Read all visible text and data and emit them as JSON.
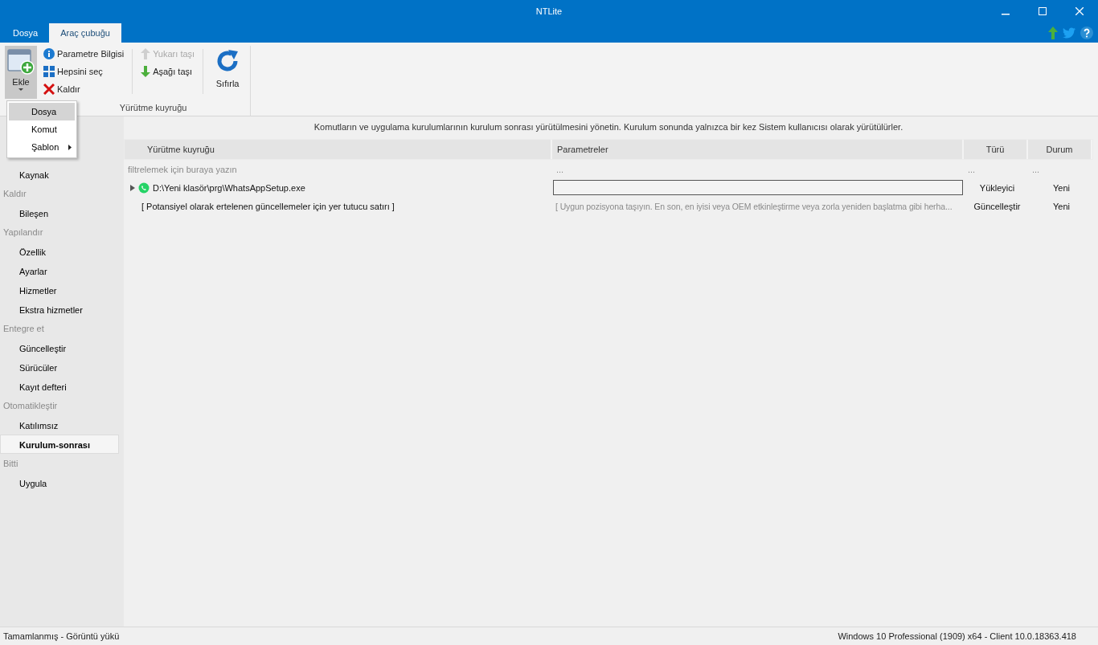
{
  "window": {
    "title": "NTLite"
  },
  "tabs": [
    {
      "label": "Dosya",
      "selected": false
    },
    {
      "label": "Araç çubuğu",
      "selected": true
    }
  ],
  "ribbon": {
    "add_button": {
      "label": "Ekle"
    },
    "small_buttons": [
      {
        "label": "Parametre Bilgisi",
        "kind": "info",
        "disabled": false
      },
      {
        "label": "Hepsini seç",
        "kind": "grid",
        "disabled": false
      },
      {
        "label": "Kaldır",
        "kind": "remove",
        "disabled": false
      }
    ],
    "move_buttons": [
      {
        "label": "Yukarı taşı",
        "kind": "up",
        "disabled": true
      },
      {
        "label": "Aşağı taşı",
        "kind": "down",
        "disabled": false
      }
    ],
    "reset_button": {
      "label": "Sıfırla"
    },
    "group_label": "Yürütme kuyruğu"
  },
  "add_menu": [
    {
      "label": "Dosya",
      "selected": true,
      "submenu": false
    },
    {
      "label": "Komut",
      "selected": false,
      "submenu": false
    },
    {
      "label": "Şablon",
      "selected": false,
      "submenu": true
    }
  ],
  "sidebar": [
    {
      "items": [
        {
          "label": "Kaynak",
          "selected": false
        }
      ]
    },
    {
      "header": "Kaldır",
      "items": [
        {
          "label": "Bileşen",
          "selected": false
        }
      ]
    },
    {
      "header": "Yapılandır",
      "items": [
        {
          "label": "Özellik",
          "selected": false
        },
        {
          "label": "Ayarlar",
          "selected": false
        },
        {
          "label": "Hizmetler",
          "selected": false
        },
        {
          "label": "Ekstra hizmetler",
          "selected": false
        }
      ]
    },
    {
      "header": "Entegre et",
      "items": [
        {
          "label": "Güncelleştir",
          "selected": false
        },
        {
          "label": "Sürücüler",
          "selected": false
        },
        {
          "label": "Kayıt defteri",
          "selected": false
        }
      ]
    },
    {
      "header": "Otomatikleştir",
      "items": [
        {
          "label": "Katılımsız",
          "selected": false
        },
        {
          "label": "Kurulum-sonrası",
          "selected": true
        }
      ]
    },
    {
      "header": "Bitti",
      "items": [
        {
          "label": "Uygula",
          "selected": false
        }
      ]
    }
  ],
  "description": "Komutların ve uygulama kurulumlarının kurulum sonrası yürütülmesini yönetin. Kurulum sonunda yalnızca bir kez Sistem kullanıcısı olarak yürütülürler.",
  "table": {
    "columns": [
      "Yürütme kuyruğu",
      "Parametreler",
      "Türü",
      "Durum"
    ],
    "filter": [
      "filtrelemek için buraya yazın",
      "...",
      "...",
      "..."
    ],
    "rows": [
      {
        "kind": "file",
        "name": "D:\\Yeni klasör\\prg\\WhatsAppSetup.exe",
        "parameters": "",
        "type": "Yükleyici",
        "status": "Yeni"
      },
      {
        "kind": "placeholder",
        "name": "[ Potansiyel olarak ertelenen güncellemeler için yer tutucu satırı ]",
        "parameters": "[ Uygun pozisyona taşıyın. En son, en iyisi veya OEM etkinleştirme veya zorla yeniden başlatma gibi herha...",
        "type": "Güncelleştir",
        "status": "Yeni"
      }
    ]
  },
  "status_bar": {
    "left": "Tamamlanmış - Görüntü yükü",
    "right": "Windows 10 Professional (1909) x64 - Client 10.0.18363.418"
  }
}
